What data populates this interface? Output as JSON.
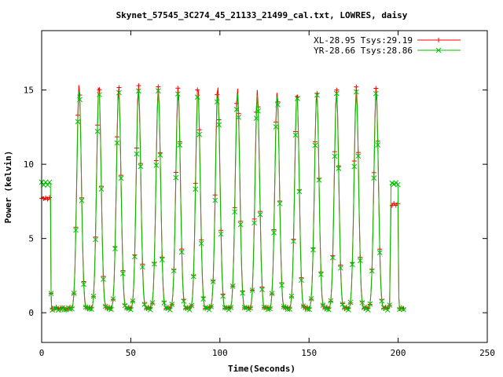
{
  "chart_data": {
    "type": "line",
    "title": "Skynet_57545_3C274_45_21133_21499_cal.txt, LOWRES, daisy",
    "xlabel": "Time(Seconds)",
    "ylabel": "Power (kelvin)",
    "xlim": [
      0,
      250
    ],
    "ylim": [
      -2,
      19
    ],
    "xticks": [
      0,
      50,
      100,
      150,
      200,
      250
    ],
    "yticks": [
      0,
      5,
      10,
      15
    ],
    "grid": false,
    "legend_position": "top-right",
    "period": 11.11,
    "first_peak": 21,
    "peak_count": 17,
    "series": [
      {
        "name": "XL-28.95 Tsys:29.19",
        "color": "#ff0000",
        "marker": "+",
        "peak_heights": [
          15.5,
          15.5,
          15.4,
          15.4,
          15.3,
          15.3,
          15.4,
          15.4,
          15.2,
          15.1,
          15.0,
          15.0,
          15.0,
          15.1,
          15.3,
          15.3,
          15.3
        ],
        "baseline": 0.3,
        "cal_on_level": 7.7,
        "cal_on_start": 0,
        "cal_on_end": 5,
        "cal_end_level": 7.3,
        "cal_end_start": 196,
        "cal_end_end": 200
      },
      {
        "name": "YR-28.66 Tsys:28.86",
        "color": "#00c000",
        "marker": "x",
        "peak_heights": [
          15.1,
          15.1,
          15.0,
          15.0,
          15.0,
          14.9,
          14.9,
          14.9,
          14.8,
          14.7,
          14.7,
          14.8,
          14.8,
          14.8,
          14.9,
          14.9,
          15.0
        ],
        "baseline": 0.25,
        "cal_on_level": 8.7,
        "cal_on_start": 0,
        "cal_on_end": 5,
        "cal_end_level": 8.7,
        "cal_end_start": 196,
        "cal_end_end": 200
      }
    ]
  }
}
